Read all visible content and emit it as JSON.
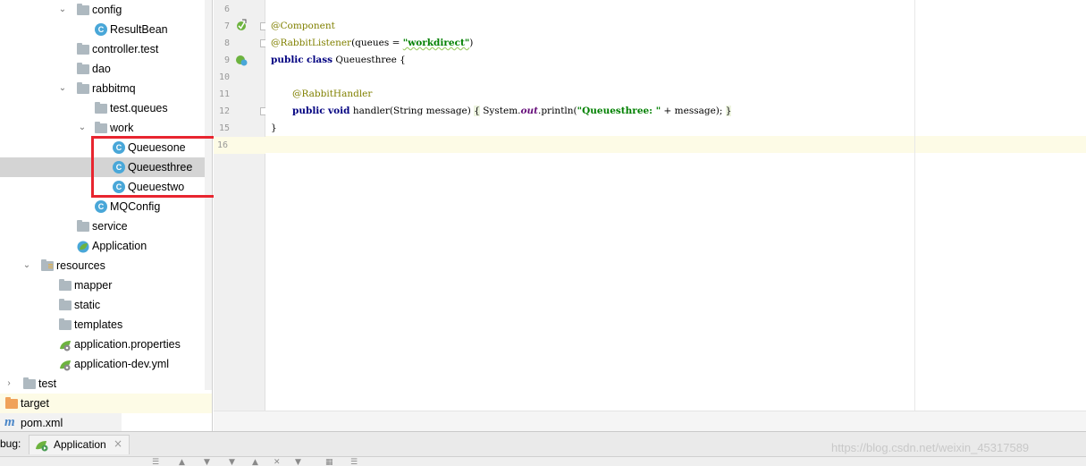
{
  "tree": {
    "items": [
      {
        "label": "config"
      },
      {
        "label": "ResultBean"
      },
      {
        "label": "controller.test"
      },
      {
        "label": "dao"
      },
      {
        "label": "rabbitmq"
      },
      {
        "label": "test.queues"
      },
      {
        "label": "work"
      },
      {
        "label": "Queuesone"
      },
      {
        "label": "Queuesthree"
      },
      {
        "label": "Queuestwo"
      },
      {
        "label": "MQConfig"
      },
      {
        "label": "service"
      },
      {
        "label": "Application"
      },
      {
        "label": "resources"
      },
      {
        "label": "mapper"
      },
      {
        "label": "static"
      },
      {
        "label": "templates"
      },
      {
        "label": "application.properties"
      },
      {
        "label": "application-dev.yml"
      },
      {
        "label": "test"
      },
      {
        "label": "target"
      },
      {
        "label": "pom.xml"
      }
    ],
    "selected_item": "Queuesthree",
    "class_icon_letter": "C",
    "maven_icon_letter": "m"
  },
  "editor": {
    "line_numbers": [
      "6",
      "7",
      "8",
      "9",
      "10",
      "11",
      "12",
      "15",
      "16"
    ],
    "current_line": "16",
    "code": {
      "l7_annotation": "@Component",
      "l8_annotation": "@RabbitListener",
      "l8_paren_open": "(queues = ",
      "l8_string": "\"workdirect\"",
      "l8_paren_close": ")",
      "l9_kw1": "public",
      "l9_kw2": "class",
      "l9_rest": " Queuesthree {",
      "l11_annotation": "@RabbitHandler",
      "l12_kw1": "public",
      "l12_kw2": "void",
      "l12_sig": " handler(String message) ",
      "l12_brace_open": "{",
      "l12_system": " System.",
      "l12_out": "out",
      "l12_println": ".println(",
      "l12_string": "\"Queuesthree: \"",
      "l12_concat": " + message); ",
      "l12_brace_close": "}",
      "l15_close": "}"
    }
  },
  "bottom": {
    "debug_label": "bug:",
    "tab_label": "Application",
    "tab_close": "×"
  },
  "watermark": "https://blog.csdn.net/weixin_45317589",
  "colors": {
    "selection_border": "#e8252f",
    "class_icon": "#49a7d8",
    "selected_row": "#d4d4d4",
    "current_line": "#fdfbe6"
  }
}
